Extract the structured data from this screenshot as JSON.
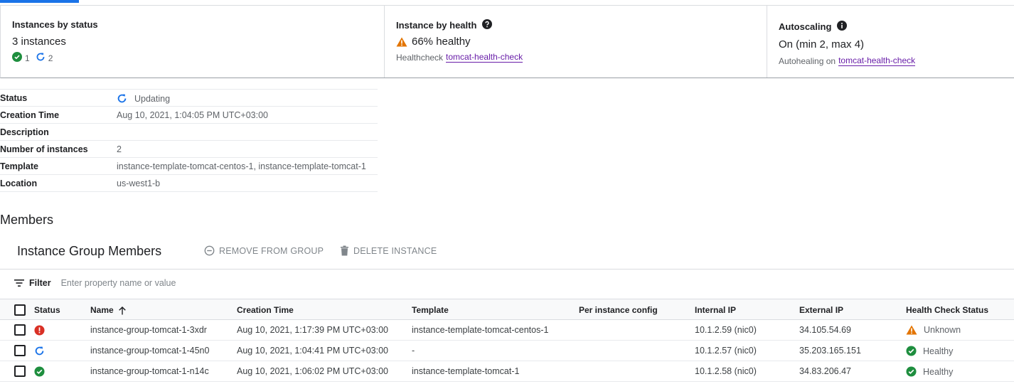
{
  "summary": {
    "status_card": {
      "title": "Instances by status",
      "instances_text": "3 instances",
      "healthy_count": "1",
      "updating_count": "2"
    },
    "health_card": {
      "title": "Instance by health",
      "value": "66% healthy",
      "sub_prefix": "Healthcheck",
      "sub_link": "tomcat-health-check"
    },
    "autoscaling_card": {
      "title": "Autoscaling",
      "value": "On (min 2, max 4)",
      "sub_prefix": "Autohealing on",
      "sub_link": "tomcat-health-check"
    }
  },
  "details": [
    {
      "key": "Status",
      "value": "Updating",
      "icon": "updating-icon"
    },
    {
      "key": "Creation Time",
      "value": "Aug 10, 2021, 1:04:05 PM UTC+03:00"
    },
    {
      "key": "Description",
      "value": ""
    },
    {
      "key": "Number of instances",
      "value": "2"
    },
    {
      "key": "Template",
      "value": "instance-template-tomcat-centos-1, instance-template-tomcat-1"
    },
    {
      "key": "Location",
      "value": "us-west1-b"
    }
  ],
  "members": {
    "heading": "Members",
    "group_title": "Instance Group Members",
    "remove_label": "REMOVE FROM GROUP",
    "delete_label": "DELETE INSTANCE",
    "filter_label": "Filter",
    "filter_placeholder": "Enter property name or value",
    "columns": {
      "status": "Status",
      "name": "Name",
      "creation_time": "Creation Time",
      "template": "Template",
      "per_instance_config": "Per instance config",
      "internal_ip": "Internal IP",
      "external_ip": "External IP",
      "health_check_status": "Health Check Status"
    },
    "rows": [
      {
        "status_icon": "error-icon",
        "name": "instance-group-tomcat-1-3xdr",
        "creation_time": "Aug 10, 2021, 1:17:39 PM UTC+03:00",
        "template": "instance-template-tomcat-centos-1",
        "per_instance_config": "",
        "internal_ip": "10.1.2.59 (nic0)",
        "external_ip": "34.105.54.69",
        "health": "Unknown",
        "health_icon": "warning-icon"
      },
      {
        "status_icon": "updating-icon",
        "name": "instance-group-tomcat-1-45n0",
        "creation_time": "Aug 10, 2021, 1:04:41 PM UTC+03:00",
        "template": "-",
        "per_instance_config": "",
        "internal_ip": "10.1.2.57 (nic0)",
        "external_ip": "35.203.165.151",
        "health": "Healthy",
        "health_icon": "check-circle-icon"
      },
      {
        "status_icon": "check-circle-icon",
        "name": "instance-group-tomcat-1-n14c",
        "creation_time": "Aug 10, 2021, 1:06:02 PM UTC+03:00",
        "template": "instance-template-tomcat-1",
        "per_instance_config": "",
        "internal_ip": "10.1.2.58 (nic0)",
        "external_ip": "34.83.206.47",
        "health": "Healthy",
        "health_icon": "check-circle-icon"
      }
    ]
  },
  "colors": {
    "accent": "#1a73e8",
    "success": "#1e8e3e",
    "error": "#d93025",
    "warning": "#e37400",
    "link": "#681da8"
  }
}
